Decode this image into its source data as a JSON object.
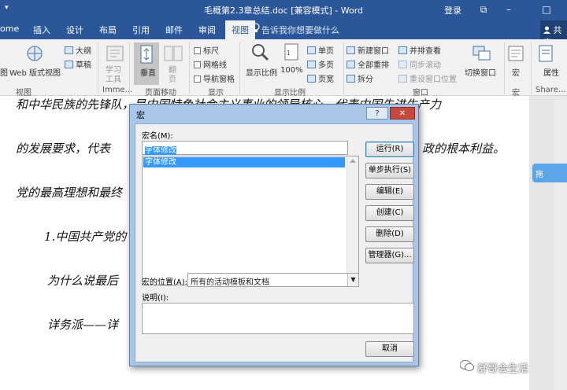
{
  "titlebar": {
    "quick_access": "▾",
    "title": "毛概第2.3章总结.doc [兼容模式] - Word",
    "login": "登录",
    "restore": "⧉",
    "minimize": "–",
    "maximize": "□"
  },
  "tabs": {
    "home": "ome",
    "insert": "插入",
    "design": "设计",
    "layout": "布局",
    "references": "引用",
    "mailings": "邮件",
    "review": "审阅",
    "view": "视图",
    "tell_me": "告诉我你想要做什么",
    "share": "共享"
  },
  "ribbon": {
    "views": {
      "read_mode": "图",
      "web_layout": "Web 版式视图",
      "outline": "大纲",
      "draft": "草稿",
      "group_label": "视图"
    },
    "immersive": {
      "learning_tools": "学习工具",
      "group_label": "Imme..."
    },
    "page_movement": {
      "vertical": "垂直",
      "side_to_side": "翻页",
      "group_label": "页面移动"
    },
    "show": {
      "ruler": "标尺",
      "gridlines": "网格线",
      "nav_pane": "导航窗格",
      "group_label": "显示"
    },
    "zoom": {
      "zoom": "显示比例",
      "hundred": "100%",
      "one_page": "单页",
      "multi_page": "多页",
      "page_width": "页宽",
      "group_label": "显示比例"
    },
    "window": {
      "new_window": "新建窗口",
      "arrange_all": "全部重排",
      "split": "拆分",
      "side_by_side": "并排查看",
      "sync_scroll": "同步滚动",
      "reset_position": "重设窗口位置",
      "switch_windows": "切换窗口",
      "group_label": "窗口"
    },
    "macros": {
      "macros": "宏",
      "group_label": "宏"
    },
    "sharepoint": {
      "properties": "属性",
      "group_label": "Share..."
    }
  },
  "document": {
    "lines": [
      "和中华民族的先锋队，是中国特色社会主义事业的领导核心，代表中国先进生产力",
      "的发展要求，代表",
      "政的根本利益。",
      "党的最高理想和最终",
      "1.中国共产党的",
      "为什么说最后",
      "详务派——详"
    ]
  },
  "side_widget": "拖",
  "watermark": "舒哥会生活",
  "dialog": {
    "title": "宏",
    "help": "?",
    "close": "✕",
    "macro_name_label": "宏名(M):",
    "macro_name_value": "字体修改",
    "list_items": [
      "字体修改"
    ],
    "location_label": "宏的位置(A):",
    "location_value": "所有的活动模板和文档",
    "description_label": "说明(I):",
    "buttons": {
      "run": "运行(R)",
      "step_into": "单步执行(S)",
      "edit": "编辑(E)",
      "create": "创建(C)",
      "delete": "删除(D)",
      "organizer": "管理器(G)...",
      "cancel": "取消"
    }
  }
}
